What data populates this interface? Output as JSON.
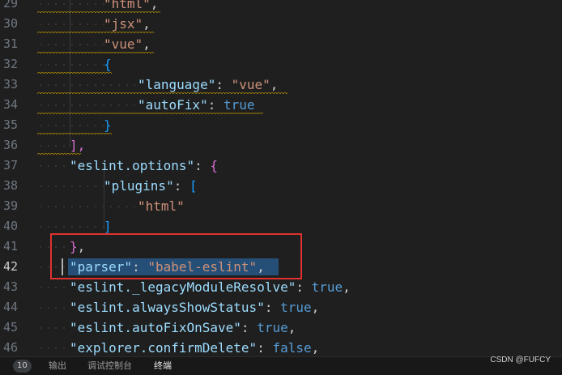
{
  "editor": {
    "line_numbers": [
      "29",
      "30",
      "31",
      "32",
      "33",
      "34",
      "35",
      "36",
      "37",
      "38",
      "39",
      "40",
      "41",
      "42",
      "43",
      "44",
      "45",
      "46"
    ],
    "active_line": "42",
    "lines": [
      [
        {
          "t": "\"html\"",
          "c": "c-str"
        },
        {
          "t": ",",
          "c": "c-punc"
        }
      ],
      [
        {
          "t": "\"jsx\"",
          "c": "c-str"
        },
        {
          "t": ",",
          "c": "c-punc"
        }
      ],
      [
        {
          "t": "\"vue\"",
          "c": "c-str"
        },
        {
          "t": ",",
          "c": "c-punc"
        }
      ],
      [
        {
          "t": "{",
          "c": "c-brace-b"
        }
      ],
      [
        {
          "t": "\"language\"",
          "c": "c-key"
        },
        {
          "t": ": ",
          "c": "c-punc"
        },
        {
          "t": "\"vue\"",
          "c": "c-str"
        },
        {
          "t": ",",
          "c": "c-punc"
        }
      ],
      [
        {
          "t": "\"autoFix\"",
          "c": "c-key"
        },
        {
          "t": ": ",
          "c": "c-punc"
        },
        {
          "t": "true",
          "c": "c-bool"
        }
      ],
      [
        {
          "t": "}",
          "c": "c-brace-b"
        }
      ],
      [
        {
          "t": "],",
          "c": "c-brace-p"
        }
      ],
      [
        {
          "t": "\"eslint.options\"",
          "c": "c-key"
        },
        {
          "t": ": ",
          "c": "c-punc"
        },
        {
          "t": "{",
          "c": "c-brace-p"
        }
      ],
      [
        {
          "t": "\"plugins\"",
          "c": "c-key"
        },
        {
          "t": ": ",
          "c": "c-punc"
        },
        {
          "t": "[",
          "c": "c-brace-b"
        }
      ],
      [
        {
          "t": "\"html\"",
          "c": "c-str"
        }
      ],
      [
        {
          "t": "]",
          "c": "c-brace-b"
        }
      ],
      [
        {
          "t": "}",
          "c": "c-brace-p"
        },
        {
          "t": ",",
          "c": "c-punc"
        }
      ],
      [
        {
          "t": "\"parser\"",
          "c": "c-key"
        },
        {
          "t": ": ",
          "c": "c-punc"
        },
        {
          "t": "\"babel-eslint\"",
          "c": "c-str"
        },
        {
          "t": ",",
          "c": "c-punc"
        }
      ],
      [
        {
          "t": "\"eslint._legacyModuleResolve\"",
          "c": "c-key"
        },
        {
          "t": ": ",
          "c": "c-punc"
        },
        {
          "t": "true",
          "c": "c-bool"
        },
        {
          "t": ",",
          "c": "c-punc"
        }
      ],
      [
        {
          "t": "\"eslint.alwaysShowStatus\"",
          "c": "c-key"
        },
        {
          "t": ": ",
          "c": "c-punc"
        },
        {
          "t": "true",
          "c": "c-bool"
        },
        {
          "t": ",",
          "c": "c-punc"
        }
      ],
      [
        {
          "t": "\"eslint.autoFixOnSave\"",
          "c": "c-key"
        },
        {
          "t": ": ",
          "c": "c-punc"
        },
        {
          "t": "true",
          "c": "c-bool"
        },
        {
          "t": ",",
          "c": "c-punc"
        }
      ],
      [
        {
          "t": "\"explorer.confirmDelete\"",
          "c": "c-key"
        },
        {
          "t": ": ",
          "c": "c-punc"
        },
        {
          "t": "false",
          "c": "c-bool"
        },
        {
          "t": ",",
          "c": "c-punc"
        }
      ]
    ]
  },
  "bottom_panel": {
    "badge": "10",
    "tabs": [
      "输出",
      "调试控制台",
      "终端"
    ]
  },
  "watermark": "CSDN @FUFCY",
  "colors": {
    "background": "#1f1f1f",
    "selection": "#264f78",
    "annotation_box": "#e03131",
    "warning_squiggle": "#c9a000"
  }
}
